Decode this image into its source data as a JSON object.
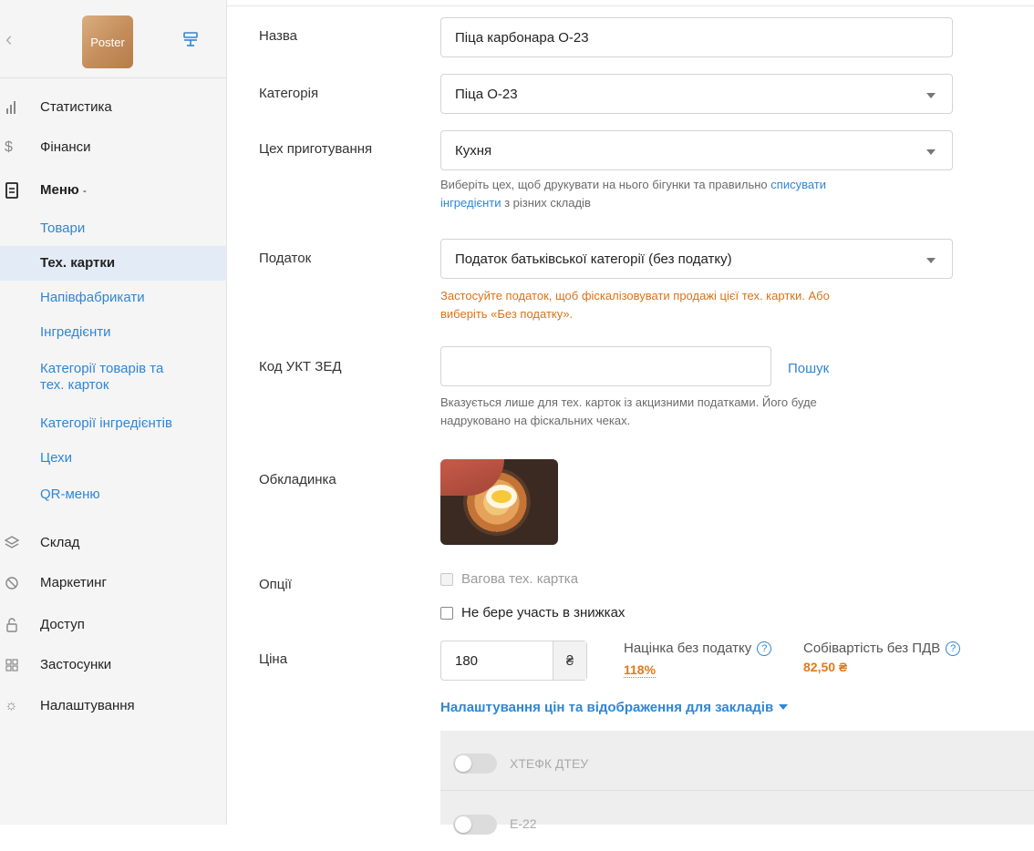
{
  "sidebar": {
    "logo_text": "Poster",
    "nav": [
      {
        "label": "Статистика",
        "icon": "bar-chart-icon"
      },
      {
        "label": "Фінанси",
        "icon": "dollar-icon"
      },
      {
        "label": "Меню",
        "icon": "document-icon"
      }
    ],
    "menu_children": [
      "Товари",
      "Тех. картки",
      "Напівфабрикати",
      "Інгредієнти",
      "Категорії товарів та",
      "тех. карток",
      "Категорії інгредієнтів",
      "Цехи",
      "QR-меню"
    ],
    "nav_bottom": [
      {
        "label": "Склад",
        "icon": "layers-icon"
      },
      {
        "label": "Маркетинг",
        "icon": "marketing-icon"
      },
      {
        "label": "Доступ",
        "icon": "lock-icon"
      },
      {
        "label": "Застосунки",
        "icon": "grid-icon"
      },
      {
        "label": "Налаштування",
        "icon": "gear-icon"
      }
    ]
  },
  "form": {
    "name_label": "Назва",
    "name_value": "Піца карбонара О-23",
    "category_label": "Категорія",
    "category_value": "Піца О-23",
    "workshop_label": "Цех приготування",
    "workshop_value": "Кухня",
    "workshop_hint_1": "Виберіть цех, щоб друкувати на нього бігунки та правильно ",
    "workshop_hint_link_1": "списувати",
    "workshop_hint_link_2": "інгредієнти",
    "workshop_hint_2": " з різних складів",
    "tax_label": "Податок",
    "tax_value": "Податок батьківської категорії (без податку)",
    "tax_warning_1": "Застосуйте податок, щоб фіскалізовувати продажі цієї тех. картки. Або",
    "tax_warning_2": "виберіть «Без податку».",
    "code_label": "Код УКТ ЗЕД",
    "code_value": "",
    "search_link": "Пошук",
    "code_hint_1": "Вказується лише для тех. карток із акцизними податками. Його буде",
    "code_hint_2": "надруковано на фіскальних чеках.",
    "cover_label": "Обкладинка",
    "options_label": "Опції",
    "option_weight": "Вагова тех. картка",
    "option_no_discount": "Не бере участь в знижках",
    "price_label": "Ціна",
    "price_value": "180",
    "currency": "₴",
    "markup_label": "Націнка без податку",
    "markup_value": "118%",
    "cost_label": "Собівартість без ПДВ",
    "cost_value": "82,50 ₴",
    "help_icon_text": "?",
    "venue_settings_link": "Налаштування цін та відображення для закладів",
    "venues": [
      "ХТЕФК ДТЕУ",
      "Е-22"
    ]
  }
}
